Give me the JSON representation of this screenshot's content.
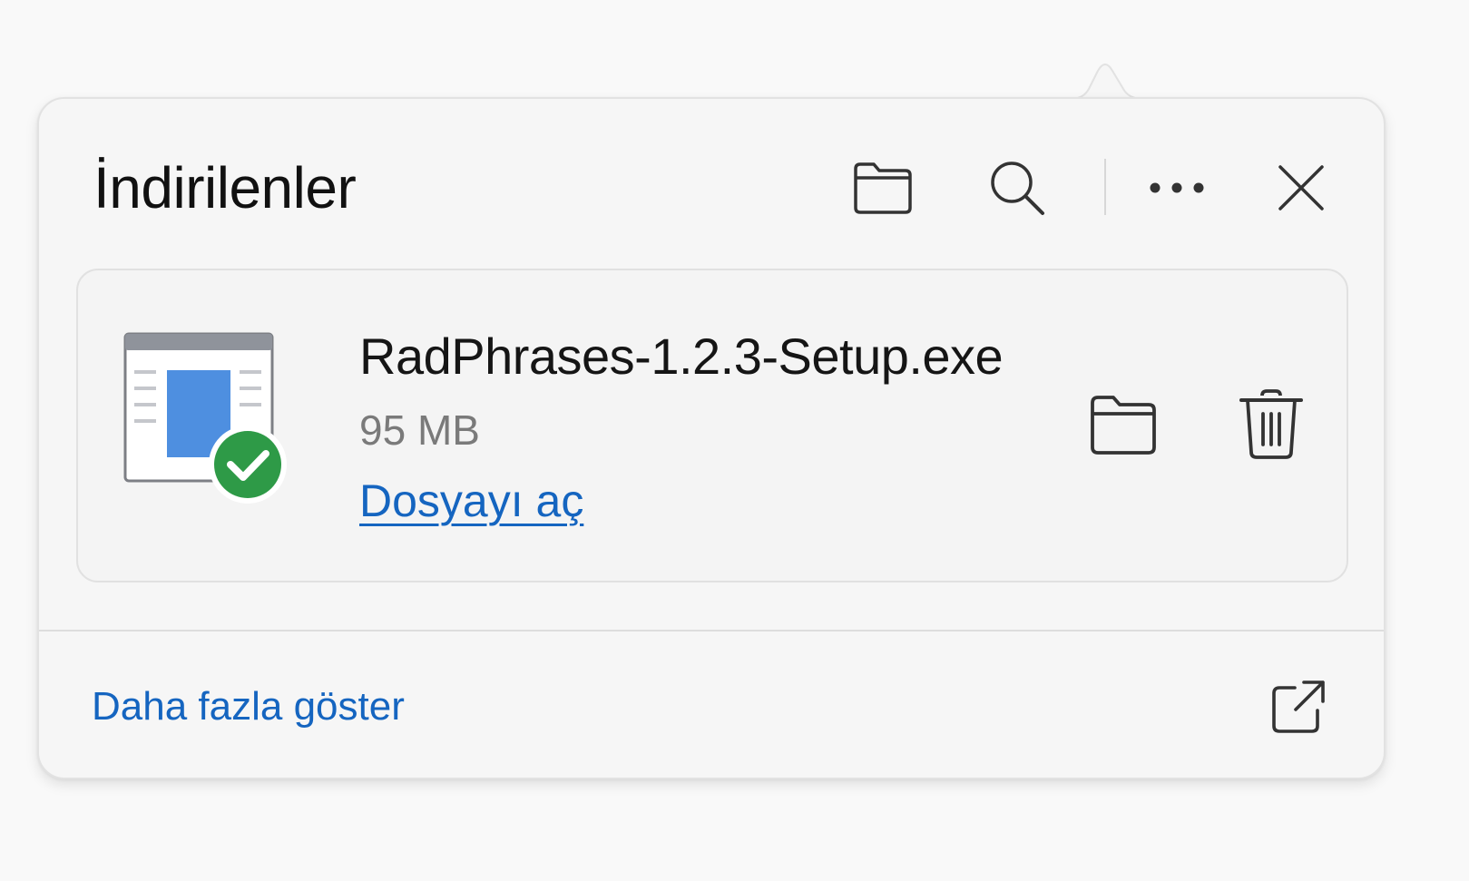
{
  "panel": {
    "title": "İndirilenler",
    "header_icons": [
      "folder-icon",
      "search-icon",
      "more-icon",
      "close-icon"
    ]
  },
  "download": {
    "file_name": "RadPhrases-1.2.3-Setup.exe",
    "size": "95 MB",
    "open_label": "Dosyayı aç",
    "status": "complete",
    "actions": [
      "folder-icon",
      "trash-icon"
    ]
  },
  "footer": {
    "more_label": "Daha fazla göster",
    "icon": "external-link-icon"
  },
  "colors": {
    "link": "#1565c0",
    "success": "#2e9a47",
    "panel_bg": "#f6f6f6"
  }
}
